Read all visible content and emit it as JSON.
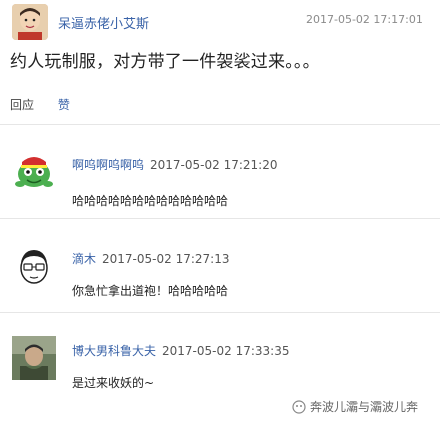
{
  "post": {
    "username": "呆逼赤佬小艾斯",
    "timestamp": "2017-05-02 17:17:01",
    "content": "约人玩制服，对方带了一件袈裟过来。。。",
    "reply_label": "回应",
    "like_label": "赞"
  },
  "comments": [
    {
      "username": "啊呜啊呜啊呜",
      "timestamp": "2017-05-02 17:21:20",
      "text": "哈哈哈哈哈哈哈哈哈哈哈哈哈"
    },
    {
      "username": "滴木",
      "timestamp": "2017-05-02 17:27:13",
      "text": "你急忙拿出道袍！哈哈哈哈哈"
    },
    {
      "username": "博大男科鲁大夫",
      "timestamp": "2017-05-02 17:33:35",
      "text": "是过来收妖的~"
    }
  ],
  "watermark": {
    "text": "奔波儿灞与灞波儿奔"
  },
  "colors": {
    "link": "#3a63a8",
    "timestamp": "#8a8a8a",
    "divider": "#e6e6e6"
  }
}
